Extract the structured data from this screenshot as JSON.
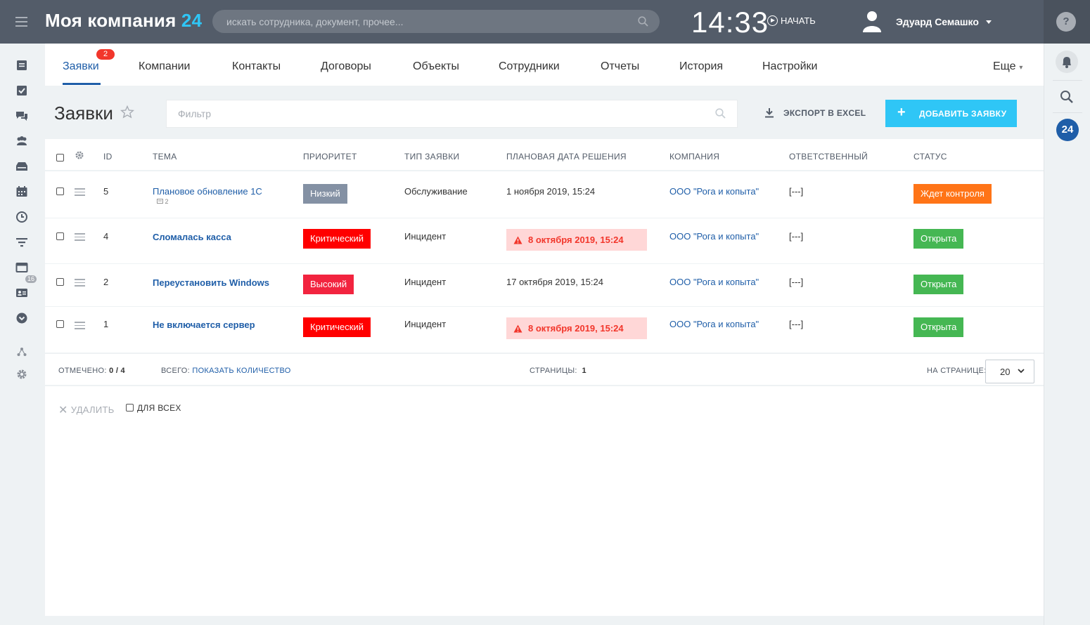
{
  "header": {
    "company_name": "Моя компания",
    "company_num": "24",
    "search_placeholder": "искать сотрудника, документ, прочее...",
    "time": "14:33",
    "start_label": "НАЧАТЬ",
    "user_name": "Эдуард Семашко",
    "help_label": "?"
  },
  "nav": {
    "tabs": [
      {
        "label": "Заявки",
        "badge": "2"
      },
      {
        "label": "Компании"
      },
      {
        "label": "Контакты"
      },
      {
        "label": "Договоры"
      },
      {
        "label": "Объекты"
      },
      {
        "label": "Сотрудники"
      },
      {
        "label": "Отчеты"
      },
      {
        "label": "История"
      },
      {
        "label": "Настройки"
      }
    ],
    "more_label": "Еще"
  },
  "left_sidebar": {
    "filter_badge": "16"
  },
  "right_sidebar": {
    "bitrix_label": "24"
  },
  "page": {
    "title": "Заявки",
    "filter_placeholder": "Фильтр",
    "export_label": "ЭКСПОРТ В EXCEL",
    "add_label": "ДОБАВИТЬ ЗАЯВКУ"
  },
  "grid": {
    "columns": [
      "ID",
      "ТЕМА",
      "ПРИОРИТЕТ",
      "ТИП ЗАЯВКИ",
      "ПЛАНОВАЯ ДАТА РЕШЕНИЯ",
      "КОМПАНИЯ",
      "ОТВЕТСТВЕННЫЙ",
      "СТАТУС"
    ],
    "rows": [
      {
        "id": "5",
        "subject": "Плановое обновление 1С",
        "comments": "2",
        "priority": "Низкий",
        "type": "Обслуживание",
        "date": "1 ноября 2019, 15:24",
        "overdue": false,
        "company": "ООО \"Рога и копыта\"",
        "responsible": "[---]",
        "status": "Ждет контроля"
      },
      {
        "id": "4",
        "subject": "Сломалась касса",
        "priority": "Критический",
        "type": "Инцидент",
        "date": "8 октября 2019, 15:24",
        "overdue": true,
        "company": "ООО \"Рога и копыта\"",
        "responsible": "[---]",
        "status": "Открыта"
      },
      {
        "id": "2",
        "subject": "Переустановить Windows",
        "priority": "Высокий",
        "type": "Инцидент",
        "date": "17 октября 2019, 15:24",
        "overdue": false,
        "company": "ООО \"Рога и копыта\"",
        "responsible": "[---]",
        "status": "Открыта"
      },
      {
        "id": "1",
        "subject": "Не включается сервер",
        "priority": "Критический",
        "type": "Инцидент",
        "date": "8 октября 2019, 15:24",
        "overdue": true,
        "company": "ООО \"Рога и копыта\"",
        "responsible": "[---]",
        "status": "Открыта"
      }
    ]
  },
  "footer": {
    "selected_label": "ОТМЕЧЕНО:",
    "selected_value": "0 / 4",
    "total_label": "ВСЕГО:",
    "total_link": "ПОКАЗАТЬ КОЛИЧЕСТВО",
    "pages_label": "СТРАНИЦЫ:",
    "pages_value": "1",
    "per_page_label": "НА СТРАНИЦЕ:",
    "per_page_value": "20"
  },
  "actions": {
    "delete_label": "УДАЛИТЬ",
    "for_all_label": "ДЛЯ ВСЕХ"
  },
  "colors": {
    "header_bg": "#535c69",
    "accent": "#2fc6f6",
    "link": "#1f5ea8",
    "priority_low": "#8491a4",
    "priority_critical": "#ff0000",
    "priority_high": "#f2243f",
    "status_wait": "#ff7417",
    "status_open": "#45b753",
    "overdue_bg": "#ffd7d7",
    "overdue_text": "#f2362b"
  }
}
